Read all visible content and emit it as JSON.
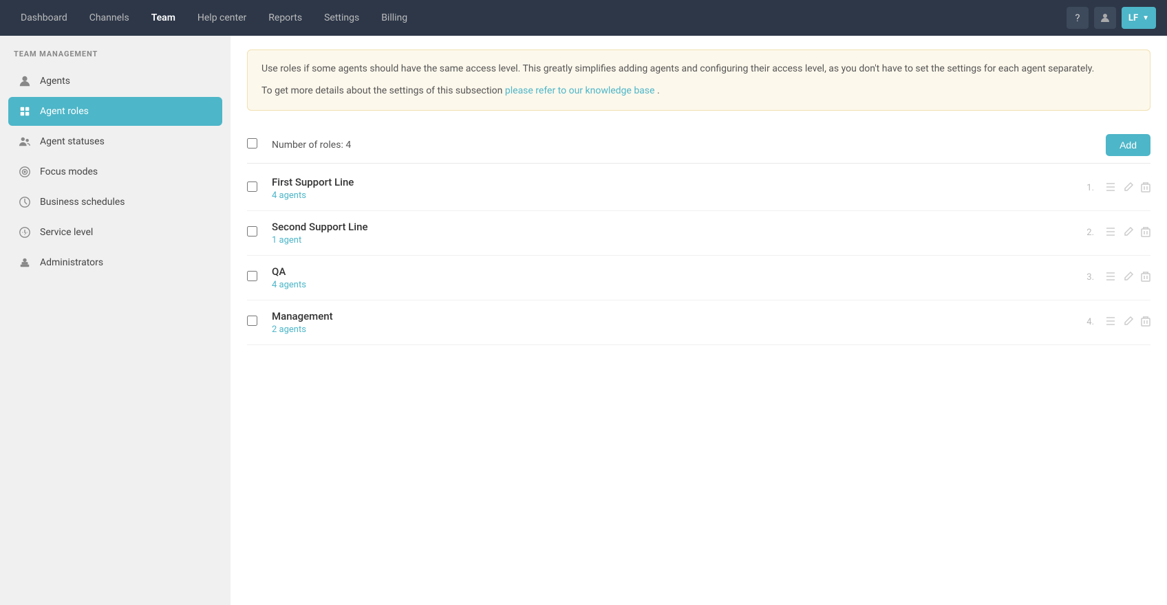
{
  "nav": {
    "items": [
      {
        "label": "Dashboard",
        "active": false
      },
      {
        "label": "Channels",
        "active": false
      },
      {
        "label": "Team",
        "active": true
      },
      {
        "label": "Help center",
        "active": false
      },
      {
        "label": "Reports",
        "active": false
      },
      {
        "label": "Settings",
        "active": false
      },
      {
        "label": "Billing",
        "active": false
      }
    ],
    "user_initials": "LF",
    "help_icon": "?",
    "user_icon": "👤"
  },
  "sidebar": {
    "section_title": "TEAM MANAGEMENT",
    "items": [
      {
        "id": "agents",
        "label": "Agents",
        "icon": "👤"
      },
      {
        "id": "agent-roles",
        "label": "Agent roles",
        "icon": "🎭",
        "active": true
      },
      {
        "id": "agent-statuses",
        "label": "Agent statuses",
        "icon": "👥"
      },
      {
        "id": "focus-modes",
        "label": "Focus modes",
        "icon": "🎯"
      },
      {
        "id": "business-schedules",
        "label": "Business schedules",
        "icon": "🕐"
      },
      {
        "id": "service-level",
        "label": "Service level",
        "icon": "⚙"
      },
      {
        "id": "administrators",
        "label": "Administrators",
        "icon": "💼"
      }
    ]
  },
  "info_banner": {
    "text1": "Use roles if some agents should have the same access level. This greatly simplifies adding agents and configuring their access level, as you don't have to set the settings for each agent separately.",
    "text2_before": "To get more details about the settings of this subsection ",
    "link_text": "please refer to our knowledge base",
    "text2_after": "."
  },
  "roles": {
    "count_label": "Number of roles:",
    "count": "4",
    "add_label": "Add",
    "items": [
      {
        "id": 1,
        "name": "First Support Line",
        "agents_label": "4 agents"
      },
      {
        "id": 2,
        "name": "Second Support Line",
        "agents_label": "1 agent"
      },
      {
        "id": 3,
        "name": "QA",
        "agents_label": "4 agents"
      },
      {
        "id": 4,
        "name": "Management",
        "agents_label": "2 agents"
      }
    ]
  }
}
